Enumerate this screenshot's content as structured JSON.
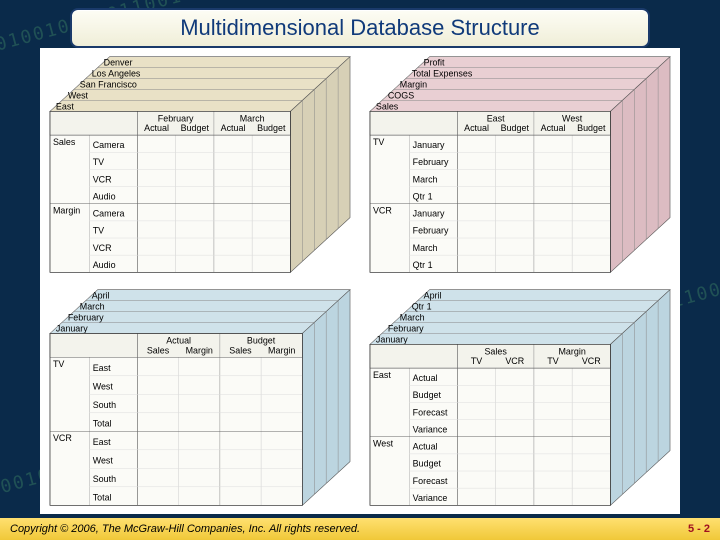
{
  "title": "Multidimensional Database Structure",
  "footer": {
    "copyright": "Copyright © 2006, The McGraw-Hill Companies, Inc. All rights reserved.",
    "page": "5 - 2"
  },
  "bg_binary": "10100101100110010",
  "cubes": {
    "tl": {
      "tint_top": "#e9e1c6",
      "tint_side": "#d7d0b6",
      "depth_rows": [
        "Denver",
        "Los Angeles",
        "San Francisco",
        "West",
        "East"
      ],
      "col_groups": [
        {
          "top": "February",
          "subs": [
            "Actual",
            "Budget"
          ]
        },
        {
          "top": "March",
          "subs": [
            "Actual",
            "Budget"
          ]
        }
      ],
      "row_groups": [
        {
          "name": "Sales",
          "subs": [
            "Camera",
            "TV",
            "VCR",
            "Audio"
          ]
        },
        {
          "name": "Margin",
          "subs": [
            "Camera",
            "TV",
            "VCR",
            "Audio"
          ]
        }
      ]
    },
    "tr": {
      "tint_top": "#e9cfd3",
      "tint_side": "#dcbcc2",
      "depth_rows": [
        "Profit",
        "Total Expenses",
        "Margin",
        "COGS",
        "Sales"
      ],
      "col_groups": [
        {
          "top": "East",
          "subs": [
            "Actual",
            "Budget"
          ]
        },
        {
          "top": "West",
          "subs": [
            "Actual",
            "Budget"
          ]
        }
      ],
      "row_groups": [
        {
          "name": "TV",
          "subs": [
            "January",
            "February",
            "March",
            "Qtr 1"
          ]
        },
        {
          "name": "VCR",
          "subs": [
            "January",
            "February",
            "March",
            "Qtr 1"
          ]
        }
      ]
    },
    "bl": {
      "tint_top": "#cfe2ea",
      "tint_side": "#bcd5e0",
      "depth_rows": [
        "April",
        "March",
        "February",
        "January"
      ],
      "col_groups": [
        {
          "top": "Actual",
          "subs": [
            "Sales",
            "Margin"
          ]
        },
        {
          "top": "Budget",
          "subs": [
            "Sales",
            "Margin"
          ]
        }
      ],
      "row_groups": [
        {
          "name": "TV",
          "subs": [
            "East",
            "West",
            "South",
            "Total"
          ]
        },
        {
          "name": "VCR",
          "subs": [
            "East",
            "West",
            "South",
            "Total"
          ]
        }
      ]
    },
    "br": {
      "tint_top": "#cfe2ea",
      "tint_side": "#bcd5e0",
      "depth_rows": [
        "April",
        "Qtr 1",
        "March",
        "February",
        "January"
      ],
      "col_groups": [
        {
          "top": "Sales",
          "subs": [
            "TV",
            "VCR"
          ]
        },
        {
          "top": "Margin",
          "subs": [
            "TV",
            "VCR"
          ]
        }
      ],
      "row_groups": [
        {
          "name": "East",
          "subs": [
            "Actual",
            "Budget",
            "Forecast",
            "Variance"
          ]
        },
        {
          "name": "West",
          "subs": [
            "Actual",
            "Budget",
            "Forecast",
            "Variance"
          ]
        }
      ]
    }
  }
}
